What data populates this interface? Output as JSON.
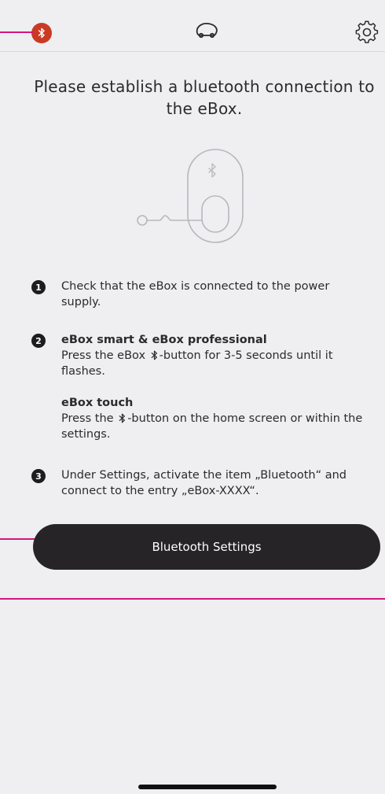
{
  "header": {
    "bluetooth_status_icon": "bluetooth-icon",
    "bluetooth_status_color": "#c93a24",
    "center_icon": "car-icon",
    "settings_icon": "gear-icon"
  },
  "main": {
    "headline": "Please establish a bluetooth connection to the eBox.",
    "illustration_icon": "ebox-bluetooth-illustration"
  },
  "steps": {
    "step1": {
      "number": "1",
      "text": "Check that the eBox is connected to the power supply."
    },
    "step2": {
      "number": "2",
      "title_a": "eBox smart & eBox professional",
      "text_a_before": "Press the eBox ",
      "text_a_after": "-button for 3-5 seconds until it flashes.",
      "title_b": "eBox touch",
      "text_b_before": "Press the ",
      "text_b_after": "-button on the home screen or within the settings."
    },
    "step3": {
      "number": "3",
      "text": "Under Settings, activate the item „Bluetooth“ and connect to the entry „eBox-XXXX“."
    }
  },
  "actions": {
    "bluetooth_settings_label": "Bluetooth Settings"
  },
  "colors": {
    "accent_callout": "#d6157a",
    "button_bg": "#262426",
    "background": "#efeef1"
  }
}
